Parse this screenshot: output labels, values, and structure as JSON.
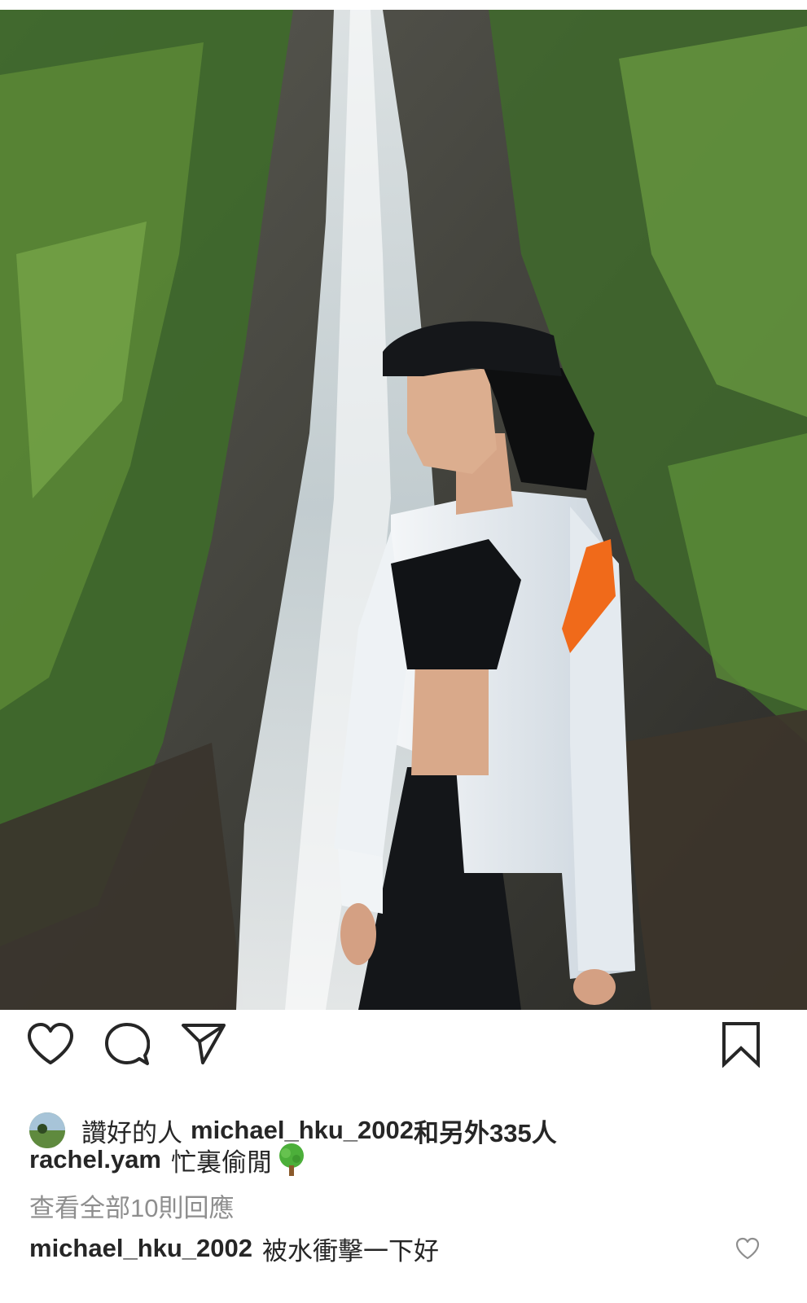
{
  "post": {
    "photo_description_icon": "photo-image",
    "likes": {
      "prefix": "讚好的人",
      "user": "michael_hku_2002",
      "suffix": "和另外335人"
    },
    "caption": {
      "user": "rachel.yam",
      "text": "忙裏偷閒",
      "emoji_icon": "tree-emoji-icon"
    },
    "view_comments_label": "查看全部10則回應",
    "comments": [
      {
        "user": "michael_hku_2002",
        "text": "被水衝擊一下好"
      }
    ]
  },
  "actions": {
    "like_icon": "heart-icon",
    "comment_icon": "comment-bubble-icon",
    "share_icon": "paper-plane-icon",
    "save_icon": "bookmark-icon"
  },
  "colors": {
    "text": "#262626",
    "muted": "#8e8e8e",
    "background": "#ffffff"
  }
}
